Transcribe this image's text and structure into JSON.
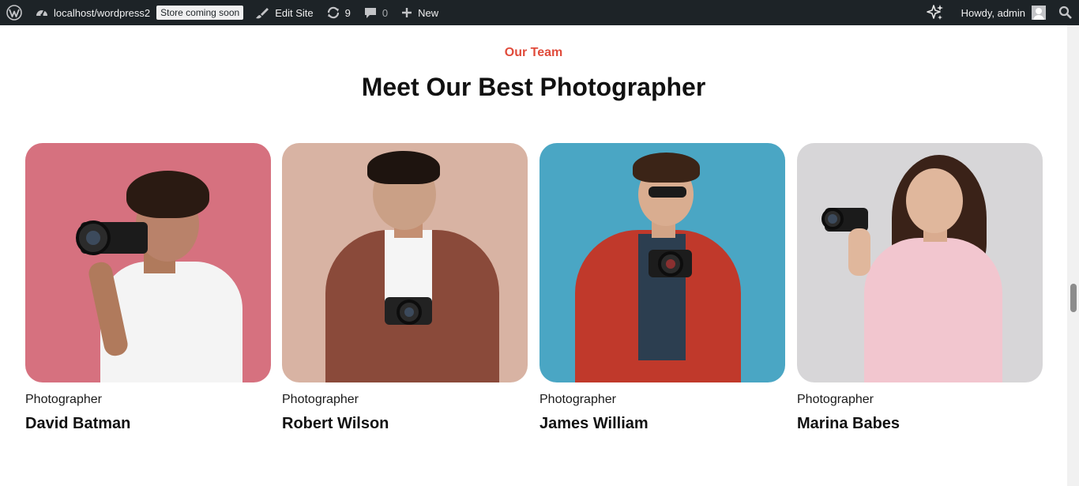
{
  "admin_bar": {
    "wp_logo_icon": "wordpress-icon",
    "site_name": "localhost/wordpress2",
    "store_badge": "Store coming soon",
    "edit_site": "Edit Site",
    "updates_count": "9",
    "comments_count": "0",
    "new_label": "New",
    "greeting": "Howdy, admin"
  },
  "section": {
    "eyebrow": "Our Team",
    "heading": "Meet Our Best Photographer"
  },
  "team": [
    {
      "role": "Photographer",
      "name": "David Batman",
      "bg": "#d6717f"
    },
    {
      "role": "Photographer",
      "name": "Robert Wilson",
      "bg": "#d8b3a3"
    },
    {
      "role": "Photographer",
      "name": "James William",
      "bg": "#4aa6c4"
    },
    {
      "role": "Photographer",
      "name": "Marina Babes",
      "bg": "#d7d6d8"
    }
  ],
  "colors": {
    "accent": "#e04b3b",
    "admin_bar_bg": "#1d2327"
  }
}
